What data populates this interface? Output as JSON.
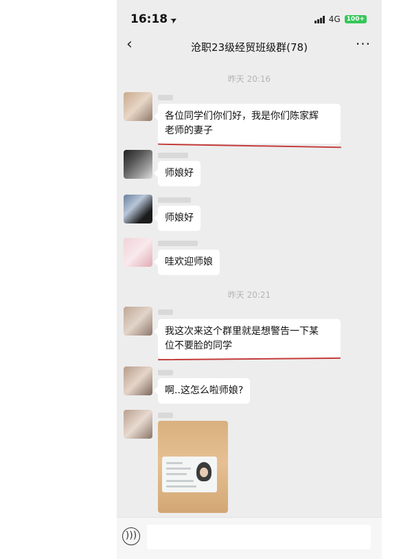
{
  "status": {
    "time": "16:18",
    "network": "4G",
    "battery": "100+"
  },
  "header": {
    "title": "沧职23级经贸班级群(78)",
    "more": "···"
  },
  "messages": [
    {
      "time": "昨天 20:16"
    },
    {
      "text_line1": "各位同学们你们好，我是你们陈家辉",
      "text_line2": "老师的妻子"
    },
    {
      "text": "师娘好"
    },
    {
      "text": "师娘好"
    },
    {
      "text": "哇欢迎师娘"
    },
    {
      "time": "昨天 20:21"
    },
    {
      "text_line1": "我这次来这个群里就是想警告一下某",
      "text_line2": "位不要脸的同学"
    },
    {
      "text": "啊..这怎么啦师娘?"
    }
  ],
  "colors": {
    "chat_bg": "#ededed",
    "bubble": "#ffffff",
    "underline": "#c43a3a",
    "battery": "#34c759"
  }
}
